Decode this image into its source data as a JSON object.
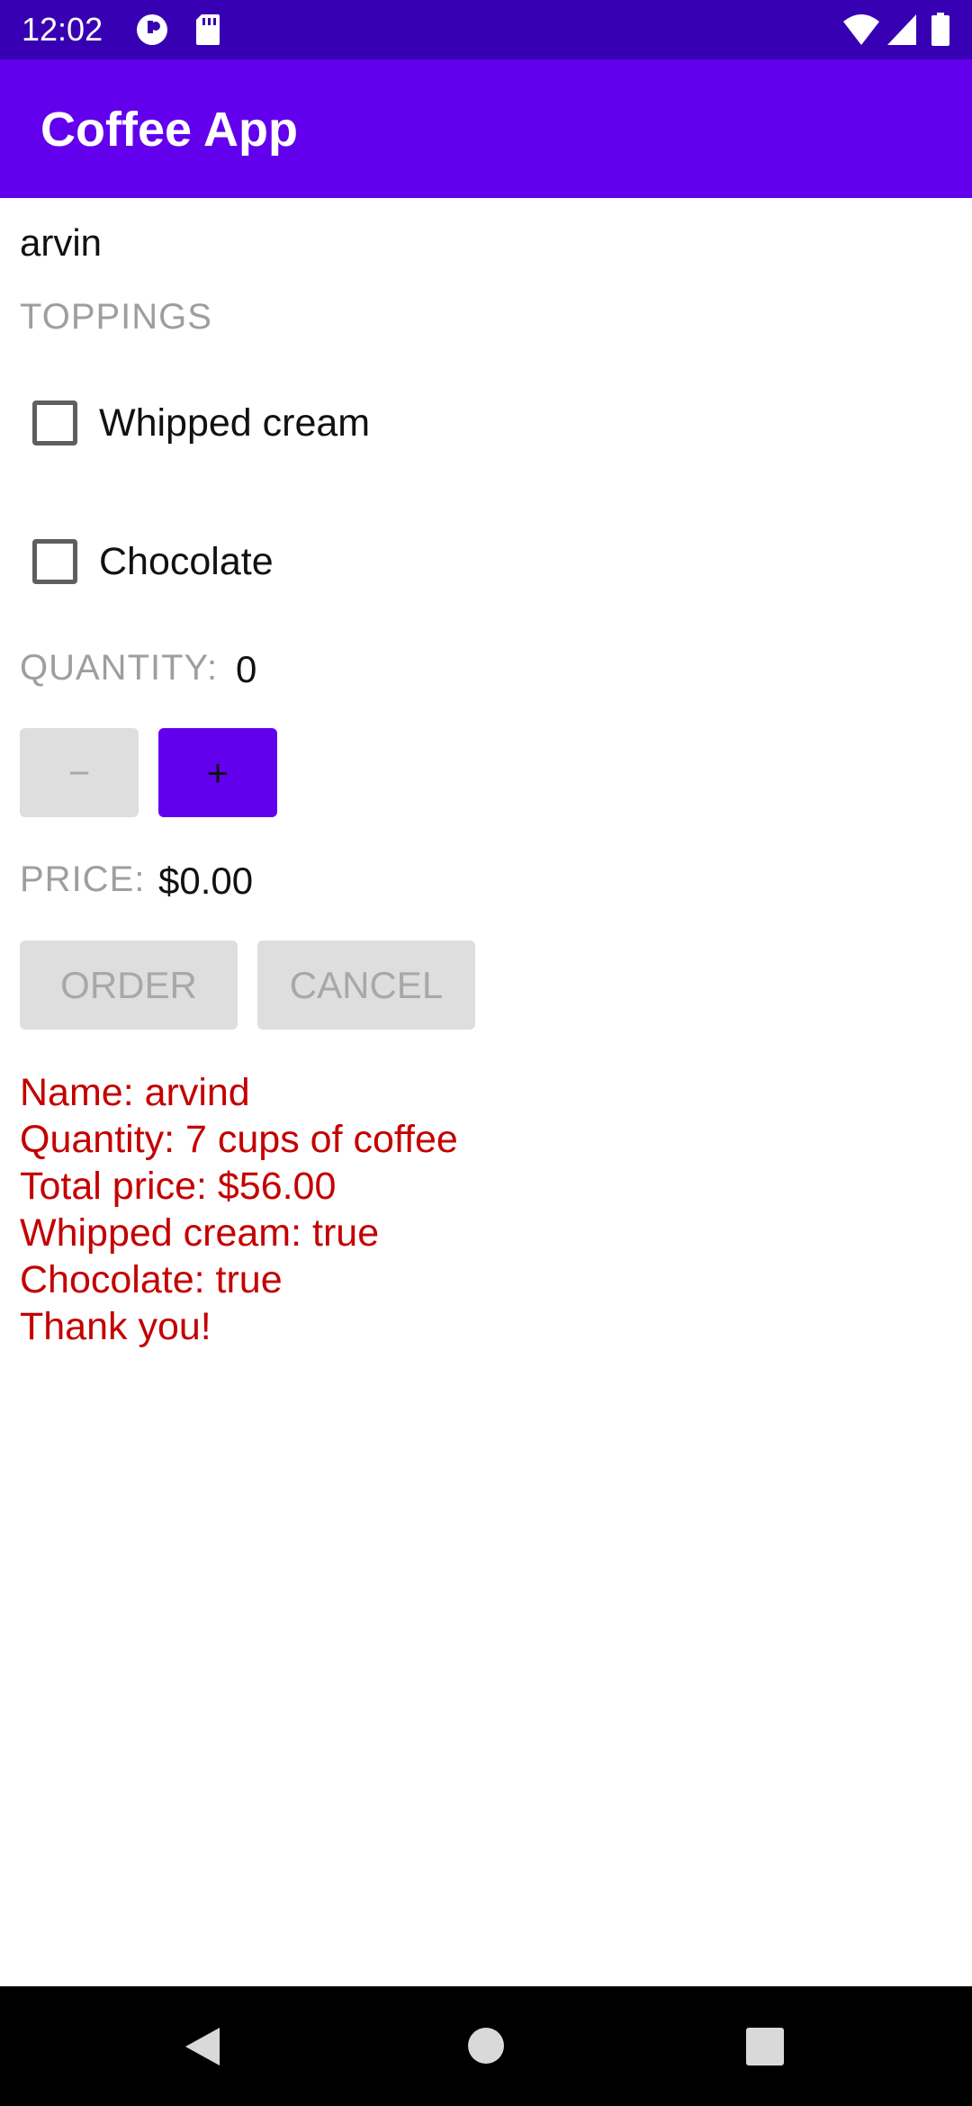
{
  "status_bar": {
    "time": "12:02",
    "left_icons": [
      "app-notification-icon",
      "sd-card-icon"
    ],
    "right_icons": [
      "wifi-icon",
      "cell-signal-icon",
      "battery-icon"
    ]
  },
  "app_bar": {
    "title": "Coffee App"
  },
  "form": {
    "name_value": "arvin",
    "toppings_label": "TOPPINGS",
    "toppings": [
      {
        "label": "Whipped cream",
        "checked": false
      },
      {
        "label": "Chocolate",
        "checked": false
      }
    ],
    "quantity_label": "QUANTITY:",
    "quantity_value": "0",
    "decrement_label": "−",
    "increment_label": "+",
    "price_label": "PRICE:",
    "price_value": "$0.00",
    "order_label": "ORDER",
    "cancel_label": "CANCEL"
  },
  "summary": {
    "lines": [
      "Name: arvind",
      "Quantity: 7 cups of coffee",
      "Total price: $56.00",
      "Whipped cream: true",
      "Chocolate: true",
      "Thank you!"
    ]
  },
  "colors": {
    "status_bar": "#3700B3",
    "app_bar": "#6200EE",
    "summary_text": "#C40000",
    "disabled_button": "#DEDEDE"
  },
  "nav_bar": {
    "icons": [
      "back-icon",
      "home-icon",
      "recents-icon"
    ]
  }
}
